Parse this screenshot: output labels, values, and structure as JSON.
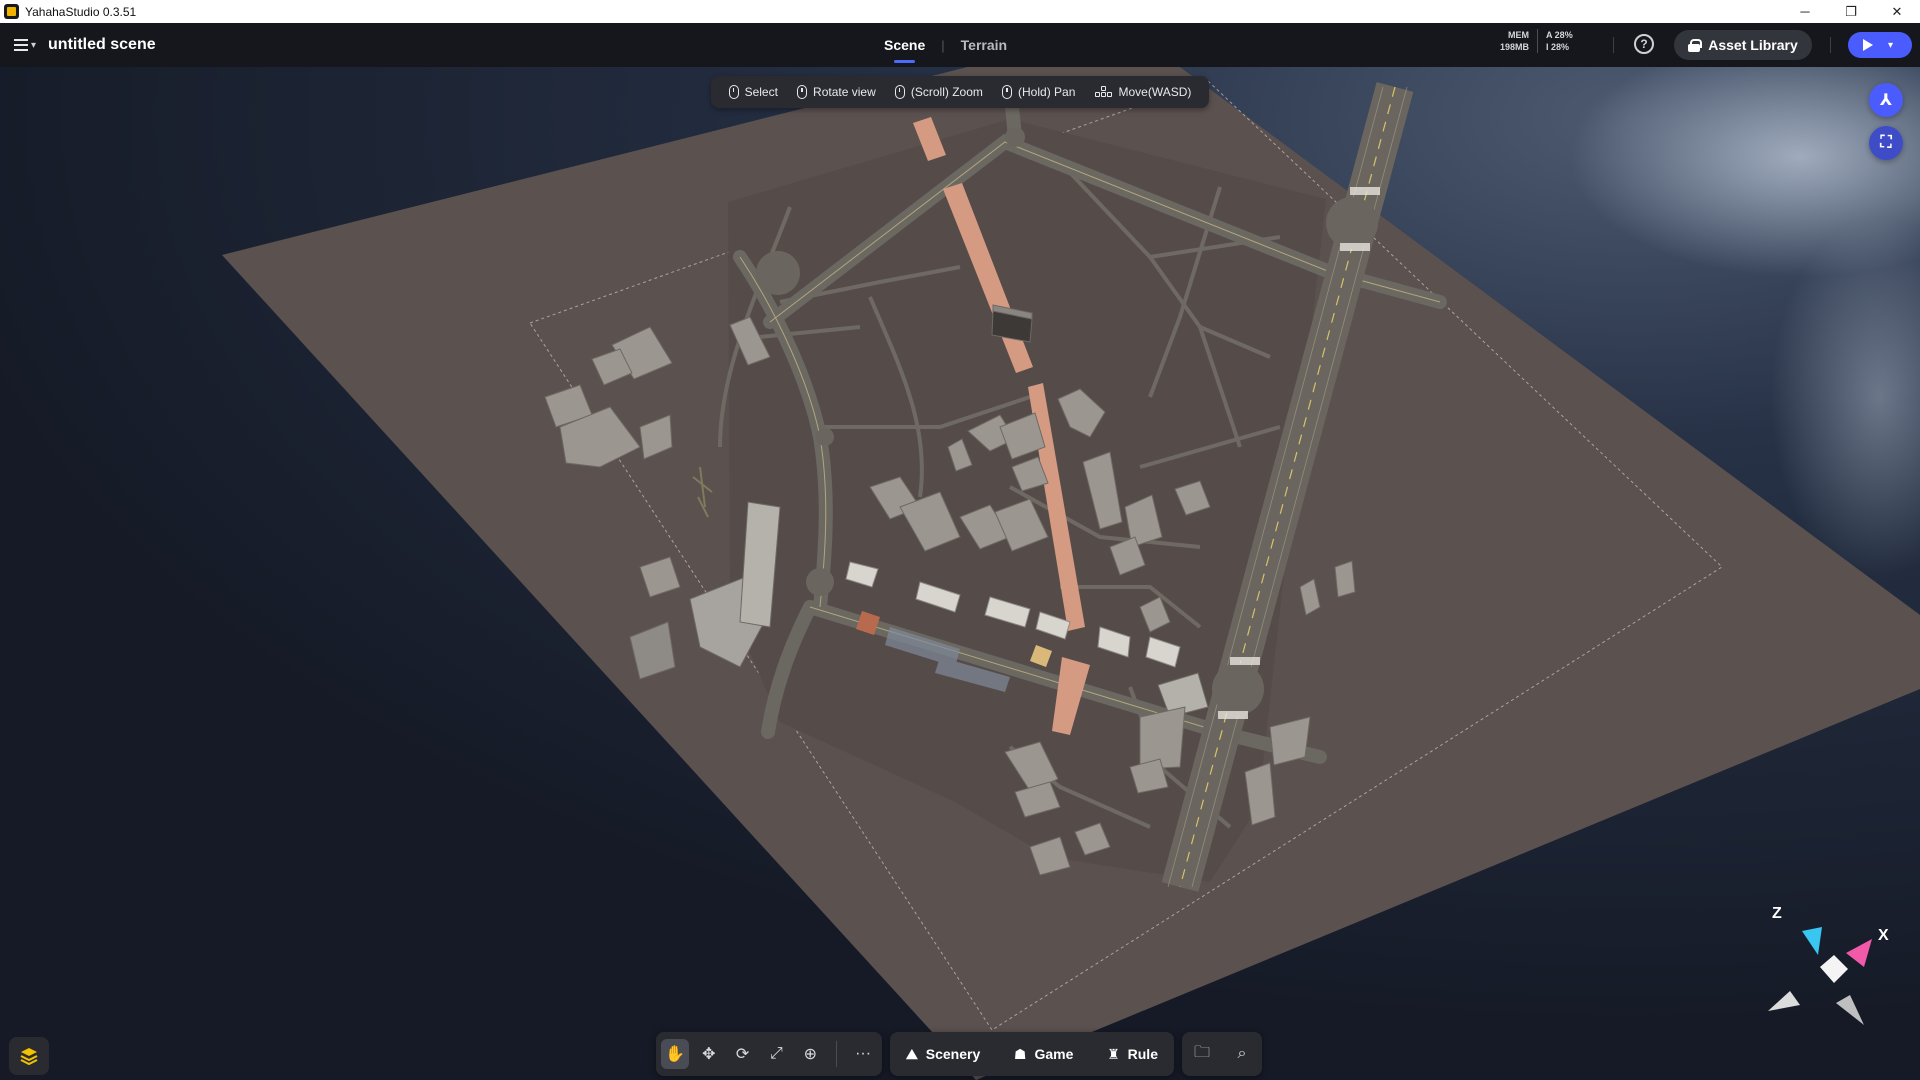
{
  "titlebar": {
    "title": "YahahaStudio 0.3.51",
    "minimize": "─",
    "maximize": "❐",
    "close": "✕"
  },
  "header": {
    "scene_title": "untitled scene",
    "tabs": [
      {
        "label": "Scene",
        "active": true
      },
      {
        "label": "Terrain",
        "active": false
      }
    ],
    "tab_separator": "|",
    "stats": {
      "mem_label": "MEM",
      "mem_value": "198MB",
      "a_label": "A 28%",
      "i_label": "I 28%"
    },
    "help": "?",
    "asset_library": "Asset Library"
  },
  "hints": {
    "select": "Select",
    "rotate": "Rotate view",
    "zoom": "(Scroll) Zoom",
    "pan": "(Hold) Pan",
    "move": "Move(WASD)"
  },
  "toolbar": {
    "more": "···",
    "scenery": "Scenery",
    "game": "Game",
    "rule": "Rule"
  },
  "gizmo": {
    "z_label": "Z",
    "x_label": "X"
  },
  "colors": {
    "accent": "#4b5cff",
    "header_bg": "#16171c",
    "terrain": "#5b514f",
    "water": "#1c2232",
    "road": "#6b6861",
    "path": "#d59a82"
  }
}
